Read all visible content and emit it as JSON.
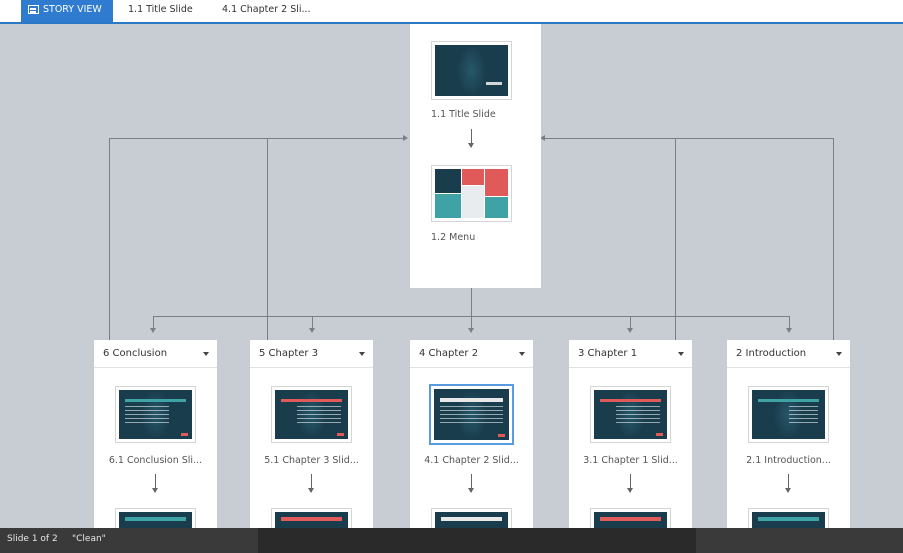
{
  "tabs": {
    "story_view": "STORY VIEW",
    "title_slide": "1.1 Title Slide",
    "chapter2": "4.1 Chapter 2 Sli..."
  },
  "main_scene": {
    "slide1_label": "1.1 Title Slide",
    "slide2_label": "1.2 Menu"
  },
  "scenes": [
    {
      "title": "6 Conclusion",
      "slide_label": "6.1 Conclusion Sli...",
      "bar_color": "#3fa3a6"
    },
    {
      "title": "5 Chapter 3",
      "slide_label": "5.1 Chapter 3 Slid...",
      "bar_color": "#e05a5a"
    },
    {
      "title": "4 Chapter 2",
      "slide_label": "4.1 Chapter 2 Slid...",
      "bar_color": "#e8e8e8"
    },
    {
      "title": "3 Chapter 1",
      "slide_label": "3.1 Chapter 1 Slid...",
      "bar_color": "#e05a5a"
    },
    {
      "title": "2 Introduction",
      "slide_label": "2.1 Introduction...",
      "bar_color": "#3fa3a6"
    }
  ],
  "status": {
    "slide": "Slide 1 of 2",
    "theme": "\"Clean\""
  },
  "colors": {
    "accent": "#2f7bd0",
    "canvas": "#c8cdd3",
    "slide_bg": "#1a3d4d",
    "menu_red": "#e05a5a",
    "menu_teal": "#3fa3a6"
  }
}
